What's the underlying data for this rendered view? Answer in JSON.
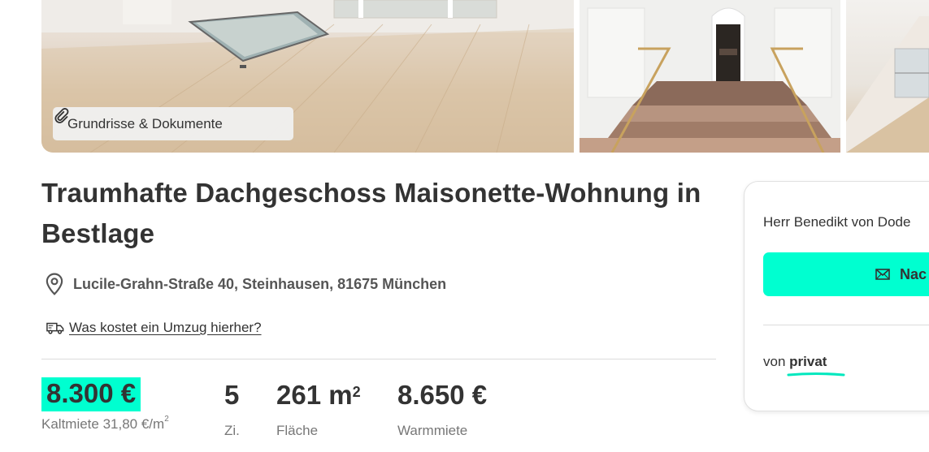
{
  "gallery": {
    "documents_button_label": "Grundrisse & Dokumente",
    "photos": [
      "photo-living-room",
      "photo-stairway",
      "photo-attic"
    ]
  },
  "listing": {
    "title": "Traumhafte Dachgeschoss Maisonette-Wohnung in Bestlage",
    "address": "Lucile-Grahn-Straße 40, Steinhausen, 81675 München",
    "moving_cost_link": "Was kostet ein Umzug hierher?"
  },
  "facts": {
    "price": {
      "value": "8.300 €",
      "label_prefix": "Kaltmiete 31,80 €/m",
      "label_sup": "2"
    },
    "rooms": {
      "value": "5",
      "label": "Zi."
    },
    "area": {
      "value": "261 m",
      "value_sup": "2",
      "label": "Fläche"
    },
    "warm": {
      "value": "8.650 €",
      "label": "Warmmiete"
    }
  },
  "contact": {
    "name": "Herr Benedikt von Dode",
    "button_label": "Nac",
    "seller_prefix": "von ",
    "seller_type": "privat"
  },
  "colors": {
    "accent": "#00ffd0",
    "text": "#333333",
    "muted": "#777777"
  }
}
